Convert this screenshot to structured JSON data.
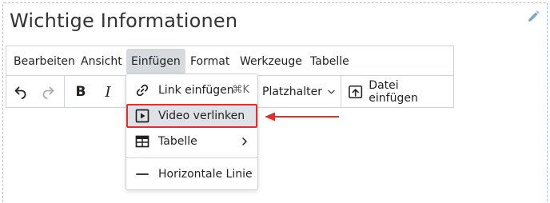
{
  "editor": {
    "title": "Wichtige Informationen"
  },
  "menubar": {
    "items": [
      "Bearbeiten",
      "Ansicht",
      "Einfügen",
      "Format",
      "Werkzeuge",
      "Tabelle"
    ],
    "active": "Einfügen"
  },
  "toolbar": {
    "bold": "B",
    "italic": "I",
    "placeholder": "Platzhalter",
    "insert_file": "Datei einfügen"
  },
  "insert_menu": {
    "link": {
      "label": "Link einfügen",
      "shortcut": "⌘K"
    },
    "video": {
      "label": "Video verlinken"
    },
    "table": {
      "label": "Tabelle"
    },
    "hr": {
      "label": "Horizontale Linie"
    }
  },
  "colors": {
    "highlight_border": "#e03127",
    "annotation_arrow": "#e03127",
    "active_menu_bg": "#d6dadf",
    "frame_dashed": "#9fc3e6",
    "edit_pencil": "#7aa7d2"
  }
}
